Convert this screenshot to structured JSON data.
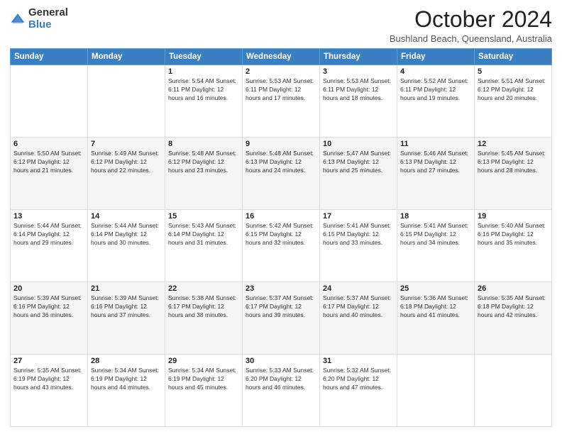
{
  "header": {
    "logo_general": "General",
    "logo_blue": "Blue",
    "month_title": "October 2024",
    "location": "Bushland Beach, Queensland, Australia"
  },
  "weekdays": [
    "Sunday",
    "Monday",
    "Tuesday",
    "Wednesday",
    "Thursday",
    "Friday",
    "Saturday"
  ],
  "weeks": [
    [
      {
        "day": "",
        "info": ""
      },
      {
        "day": "",
        "info": ""
      },
      {
        "day": "1",
        "info": "Sunrise: 5:54 AM\nSunset: 6:11 PM\nDaylight: 12 hours and 16 minutes."
      },
      {
        "day": "2",
        "info": "Sunrise: 5:53 AM\nSunset: 6:11 PM\nDaylight: 12 hours and 17 minutes."
      },
      {
        "day": "3",
        "info": "Sunrise: 5:53 AM\nSunset: 6:11 PM\nDaylight: 12 hours and 18 minutes."
      },
      {
        "day": "4",
        "info": "Sunrise: 5:52 AM\nSunset: 6:11 PM\nDaylight: 12 hours and 19 minutes."
      },
      {
        "day": "5",
        "info": "Sunrise: 5:51 AM\nSunset: 6:12 PM\nDaylight: 12 hours and 20 minutes."
      }
    ],
    [
      {
        "day": "6",
        "info": "Sunrise: 5:50 AM\nSunset: 6:12 PM\nDaylight: 12 hours and 21 minutes."
      },
      {
        "day": "7",
        "info": "Sunrise: 5:49 AM\nSunset: 6:12 PM\nDaylight: 12 hours and 22 minutes."
      },
      {
        "day": "8",
        "info": "Sunrise: 5:48 AM\nSunset: 6:12 PM\nDaylight: 12 hours and 23 minutes."
      },
      {
        "day": "9",
        "info": "Sunrise: 5:48 AM\nSunset: 6:13 PM\nDaylight: 12 hours and 24 minutes."
      },
      {
        "day": "10",
        "info": "Sunrise: 5:47 AM\nSunset: 6:13 PM\nDaylight: 12 hours and 25 minutes."
      },
      {
        "day": "11",
        "info": "Sunrise: 5:46 AM\nSunset: 6:13 PM\nDaylight: 12 hours and 27 minutes."
      },
      {
        "day": "12",
        "info": "Sunrise: 5:45 AM\nSunset: 6:13 PM\nDaylight: 12 hours and 28 minutes."
      }
    ],
    [
      {
        "day": "13",
        "info": "Sunrise: 5:44 AM\nSunset: 6:14 PM\nDaylight: 12 hours and 29 minutes."
      },
      {
        "day": "14",
        "info": "Sunrise: 5:44 AM\nSunset: 6:14 PM\nDaylight: 12 hours and 30 minutes."
      },
      {
        "day": "15",
        "info": "Sunrise: 5:43 AM\nSunset: 6:14 PM\nDaylight: 12 hours and 31 minutes."
      },
      {
        "day": "16",
        "info": "Sunrise: 5:42 AM\nSunset: 6:15 PM\nDaylight: 12 hours and 32 minutes."
      },
      {
        "day": "17",
        "info": "Sunrise: 5:41 AM\nSunset: 6:15 PM\nDaylight: 12 hours and 33 minutes."
      },
      {
        "day": "18",
        "info": "Sunrise: 5:41 AM\nSunset: 6:15 PM\nDaylight: 12 hours and 34 minutes."
      },
      {
        "day": "19",
        "info": "Sunrise: 5:40 AM\nSunset: 6:16 PM\nDaylight: 12 hours and 35 minutes."
      }
    ],
    [
      {
        "day": "20",
        "info": "Sunrise: 5:39 AM\nSunset: 6:16 PM\nDaylight: 12 hours and 36 minutes."
      },
      {
        "day": "21",
        "info": "Sunrise: 5:39 AM\nSunset: 6:16 PM\nDaylight: 12 hours and 37 minutes."
      },
      {
        "day": "22",
        "info": "Sunrise: 5:38 AM\nSunset: 6:17 PM\nDaylight: 12 hours and 38 minutes."
      },
      {
        "day": "23",
        "info": "Sunrise: 5:37 AM\nSunset: 6:17 PM\nDaylight: 12 hours and 39 minutes."
      },
      {
        "day": "24",
        "info": "Sunrise: 5:37 AM\nSunset: 6:17 PM\nDaylight: 12 hours and 40 minutes."
      },
      {
        "day": "25",
        "info": "Sunrise: 5:36 AM\nSunset: 6:18 PM\nDaylight: 12 hours and 41 minutes."
      },
      {
        "day": "26",
        "info": "Sunrise: 5:35 AM\nSunset: 6:18 PM\nDaylight: 12 hours and 42 minutes."
      }
    ],
    [
      {
        "day": "27",
        "info": "Sunrise: 5:35 AM\nSunset: 6:19 PM\nDaylight: 12 hours and 43 minutes."
      },
      {
        "day": "28",
        "info": "Sunrise: 5:34 AM\nSunset: 6:19 PM\nDaylight: 12 hours and 44 minutes."
      },
      {
        "day": "29",
        "info": "Sunrise: 5:34 AM\nSunset: 6:19 PM\nDaylight: 12 hours and 45 minutes."
      },
      {
        "day": "30",
        "info": "Sunrise: 5:33 AM\nSunset: 6:20 PM\nDaylight: 12 hours and 46 minutes."
      },
      {
        "day": "31",
        "info": "Sunrise: 5:32 AM\nSunset: 6:20 PM\nDaylight: 12 hours and 47 minutes."
      },
      {
        "day": "",
        "info": ""
      },
      {
        "day": "",
        "info": ""
      }
    ]
  ]
}
